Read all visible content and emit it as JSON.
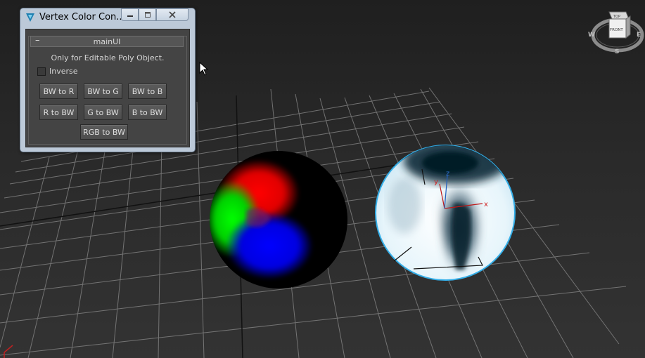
{
  "window": {
    "title": "Vertex Color Con...",
    "rollout_title": "mainUI",
    "collapse_symbol": "–"
  },
  "panel": {
    "info_text": "Only for Editable Poly Object.",
    "inverse_label": "Inverse",
    "inverse_checked": false,
    "buttons": {
      "bw_to_r": "BW to R",
      "bw_to_g": "BW to G",
      "bw_to_b": "BW to B",
      "r_to_bw": "R to BW",
      "g_to_bw": "G to BW",
      "b_to_bw": "B to BW",
      "rgb_to_bw": "RGB to BW"
    }
  },
  "viewcube": {
    "face_top": "TOP",
    "face_front": "FRONT",
    "compass_w": "W",
    "compass_e": "E",
    "compass_s": "S"
  },
  "gizmo": {
    "x": "x",
    "y": "y",
    "z": "z"
  },
  "colors": {
    "viewport_bg": "#2b2b2b",
    "grid_line": "#8a8a8a",
    "sphere_red": "#ff0000",
    "sphere_green": "#00e000",
    "sphere_blue": "#0000ff",
    "sphere2_highlight": "#33aee8",
    "panel_bg": "#444444",
    "window_frame": "#bcc9d8"
  },
  "icons": [
    "app-icon",
    "minimize-icon",
    "maximize-icon",
    "close-icon",
    "mouse-cursor-icon"
  ]
}
